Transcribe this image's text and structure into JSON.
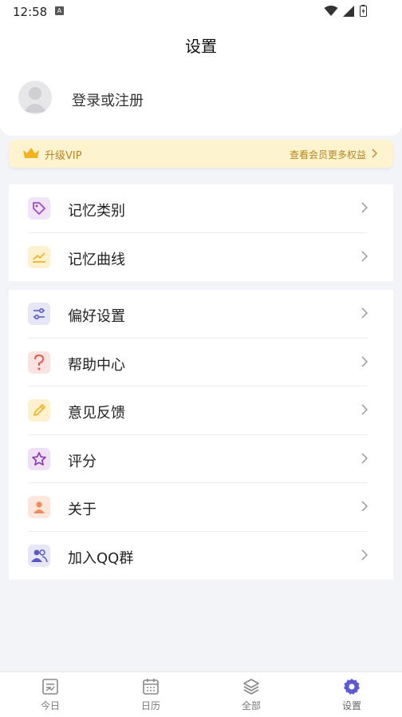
{
  "status": {
    "time": "12:58",
    "notif_glyph": "A"
  },
  "header": {
    "title": "设置",
    "login_text": "登录或注册"
  },
  "vip": {
    "label": "升级VIP",
    "more": "查看会员更多权益"
  },
  "group1": [
    {
      "label": "记忆类别",
      "icon": "tag-icon",
      "color": "#a34bc6"
    },
    {
      "label": "记忆曲线",
      "icon": "chart-icon",
      "color": "#f2b52b"
    }
  ],
  "group2": [
    {
      "label": "偏好设置",
      "icon": "sliders-icon",
      "color": "#5a57c7"
    },
    {
      "label": "帮助中心",
      "icon": "question-icon",
      "color": "#e55a4f"
    },
    {
      "label": "意见反馈",
      "icon": "pencil-icon",
      "color": "#f2b52b"
    },
    {
      "label": "评分",
      "icon": "star-icon",
      "color": "#8a3db8"
    },
    {
      "label": "关于",
      "icon": "person-icon",
      "color": "#f08a5d"
    },
    {
      "label": "加入QQ群",
      "icon": "group-icon",
      "color": "#5a57c7"
    }
  ],
  "tabs": [
    {
      "label": "今日",
      "icon": "today-icon"
    },
    {
      "label": "日历",
      "icon": "calendar-icon"
    },
    {
      "label": "全部",
      "icon": "layers-icon"
    },
    {
      "label": "设置",
      "icon": "settings-gear-icon",
      "active": true
    }
  ],
  "colors": {
    "accent": "#5b5bd6",
    "vip_text": "#b88720",
    "vip_bg": "#fdf3cf"
  }
}
